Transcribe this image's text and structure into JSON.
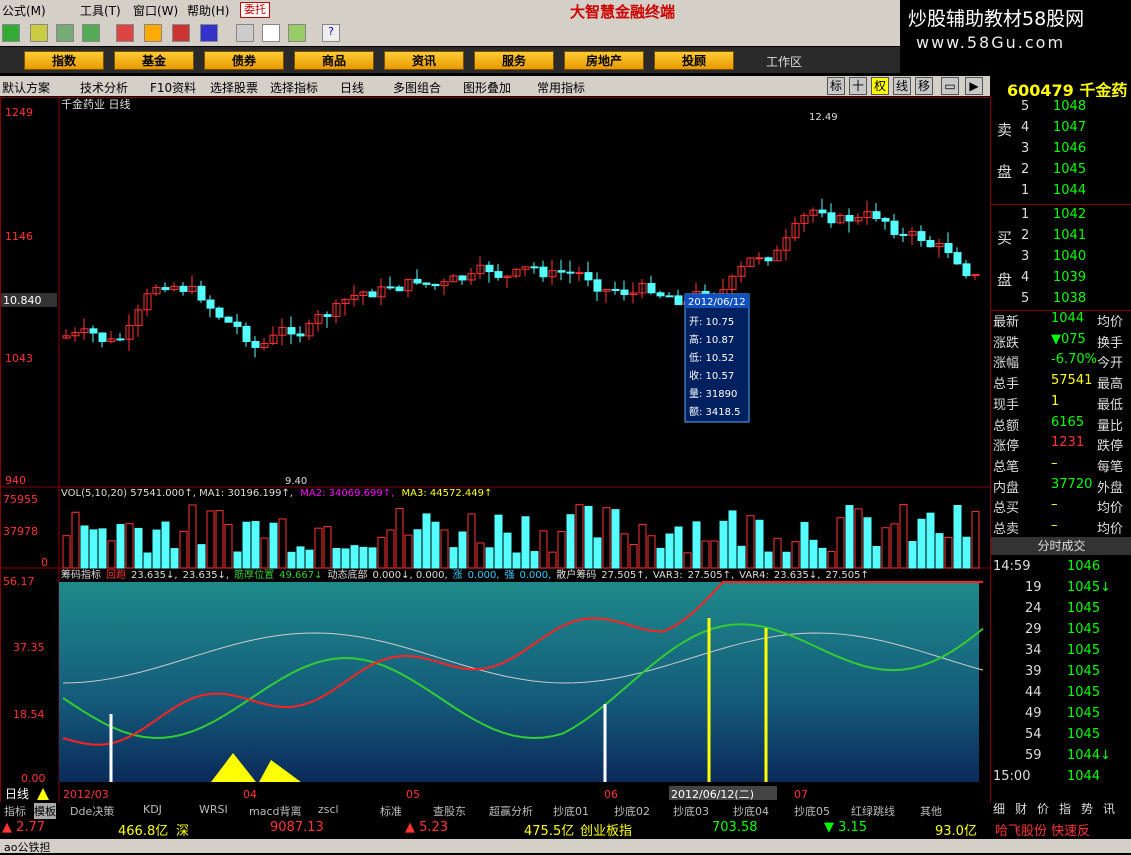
{
  "menu": {
    "items": [
      "公式(M)",
      "工具(T)",
      "窗口(W)",
      "帮助(H)"
    ],
    "weituo": "委托",
    "brand": "大智慧金融终端"
  },
  "watermark": {
    "line1": "炒股辅助教材58股网",
    "line2": "www.58Gu.com"
  },
  "nav": {
    "buttons": [
      "指数",
      "基金",
      "债券",
      "商品",
      "资讯",
      "服务",
      "房地产",
      "投顾"
    ],
    "workspace": "工作区"
  },
  "func": {
    "items": [
      "默认方案",
      "技术分析",
      "F10资料",
      "选择股票",
      "选择指标",
      "日线",
      "多图组合",
      "图形叠加",
      "常用指标"
    ],
    "right_buttons": [
      "标",
      "十",
      "权",
      "线",
      "移"
    ]
  },
  "stock": {
    "code": "600479",
    "name": "千金药"
  },
  "chart": {
    "title": "千金药业 日线",
    "price_labels": {
      "top": "1249",
      "mid": "1146",
      "cur": "10.840",
      "low1": "1043",
      "bot": "940"
    },
    "max_label": "12.49",
    "min_label": "9.40",
    "tooltip": {
      "date": "2012/06/12",
      "rows": [
        [
          "开",
          "10.75"
        ],
        [
          "高",
          "10.87"
        ],
        [
          "低",
          "10.52"
        ],
        [
          "收",
          "10.57"
        ],
        [
          "量",
          "31890"
        ],
        [
          "额",
          "3418.5"
        ]
      ]
    },
    "vol_header": [
      {
        "t": "VOL(5,10,20) 57541.000↑, MA1: 30196.199↑,",
        "c": "#ddd"
      },
      {
        "t": "MA2: 34069.699↑,",
        "c": "#f0f"
      },
      {
        "t": "MA3: 44572.449↑",
        "c": "#ff0"
      }
    ],
    "vol_labels": {
      "top": "75955",
      "mid": "37978",
      "bot": "0"
    },
    "ind_header": [
      {
        "t": "筹码指标",
        "c": "#ddd"
      },
      {
        "t": "回跑",
        "c": "#f33"
      },
      {
        "t": "23.635↓,",
        "c": "#ddd"
      },
      {
        "t": "23.635↓,",
        "c": "#ddd"
      },
      {
        "t": "筋厚位置",
        "c": "#3c3"
      },
      {
        "t": "49.667↓",
        "c": "#3c3"
      },
      {
        "t": "动态底部",
        "c": "#ddd"
      },
      {
        "t": "0.000↓, 0.000,",
        "c": "#ddd"
      },
      {
        "t": "涨",
        "c": "#3cf"
      },
      {
        "t": "0.000,",
        "c": "#3cf"
      },
      {
        "t": "强",
        "c": "#3cf"
      },
      {
        "t": "0.000,",
        "c": "#3cf"
      },
      {
        "t": "散户筹码",
        "c": "#ddd"
      },
      {
        "t": "27.505↑,",
        "c": "#ddd"
      },
      {
        "t": "VAR3:",
        "c": "#ddd"
      },
      {
        "t": "27.505↑,",
        "c": "#ddd"
      },
      {
        "t": "VAR4:",
        "c": "#ddd"
      },
      {
        "t": "23.635↓,",
        "c": "#ddd"
      },
      {
        "t": "27.505↑",
        "c": "#ddd"
      }
    ],
    "ind_labels": {
      "top": "56.17",
      "mid1": "37.35",
      "mid2": "18.54",
      "bot": "0.00"
    },
    "period": "日线",
    "xaxis": [
      "2012/03",
      "04",
      "05",
      "06",
      "2012/06/12(二)",
      "07"
    ]
  },
  "quote": {
    "sell": [
      [
        "5",
        "1048"
      ],
      [
        "4",
        "1047"
      ],
      [
        "3",
        "1046"
      ],
      [
        "2",
        "1045"
      ],
      [
        "1",
        "1044"
      ]
    ],
    "buy": [
      [
        "1",
        "1042"
      ],
      [
        "2",
        "1041"
      ],
      [
        "3",
        "1040"
      ],
      [
        "4",
        "1039"
      ],
      [
        "5",
        "1038"
      ]
    ],
    "sell_label": [
      "卖",
      "盘"
    ],
    "buy_label": [
      "买",
      "盘"
    ],
    "stats": [
      [
        "最新",
        "1044",
        "均价"
      ],
      [
        "涨跌",
        "▼075",
        "换手"
      ],
      [
        "涨幅",
        "-6.70%",
        "今开"
      ],
      [
        "总手",
        "57541",
        "最高"
      ],
      [
        "现手",
        "1",
        "最低"
      ],
      [
        "总额",
        "6165",
        "量比"
      ],
      [
        "涨停",
        "1231",
        "跌停"
      ],
      [
        "总笔",
        "–",
        "每笔"
      ],
      [
        "内盘",
        "37720",
        "外盘"
      ],
      [
        "总买",
        "–",
        "均价"
      ],
      [
        "总卖",
        "–",
        "均价"
      ]
    ],
    "ticks_title": "分时成交",
    "ticks": [
      [
        "14:59",
        "1046"
      ],
      [
        "19",
        "1045↓"
      ],
      [
        "24",
        "1045"
      ],
      [
        "29",
        "1045"
      ],
      [
        "34",
        "1045"
      ],
      [
        "39",
        "1045"
      ],
      [
        "44",
        "1045"
      ],
      [
        "49",
        "1045"
      ],
      [
        "54",
        "1045"
      ],
      [
        "59",
        "1044↓"
      ],
      [
        "15:00",
        "1044"
      ]
    ],
    "tabs": [
      "细",
      "财",
      "价",
      "指",
      "势",
      "讯"
    ]
  },
  "bottomtabs": [
    "指标",
    "模板",
    "Dde决策",
    "KDJ",
    "WRSI",
    "macd背离",
    "zscl",
    "标准",
    "查股东",
    "超赢分析",
    "抄底01",
    "抄底02",
    "抄底03",
    "抄底04",
    "抄底05",
    "红绿跳线",
    "其他"
  ],
  "status": [
    {
      "t": "▲ 2.77",
      "c": "#f33"
    },
    {
      "t": "466.8亿",
      "c": "#ff0"
    },
    {
      "t": "深",
      "c": "#ff0"
    },
    {
      "t": "9087.13",
      "c": "#f33"
    },
    {
      "t": "▲ 5.23",
      "c": "#f33"
    },
    {
      "t": "475.5亿",
      "c": "#ff0"
    },
    {
      "t": "创业板指",
      "c": "#ff0"
    },
    {
      "t": "703.58",
      "c": "#0f0"
    },
    {
      "t": "▼ 3.15",
      "c": "#0f0"
    },
    {
      "t": "93.0亿",
      "c": "#ff0"
    },
    {
      "t": "哈飞股份 快速反",
      "c": "#f33"
    }
  ],
  "footer": "ao公铁担"
}
